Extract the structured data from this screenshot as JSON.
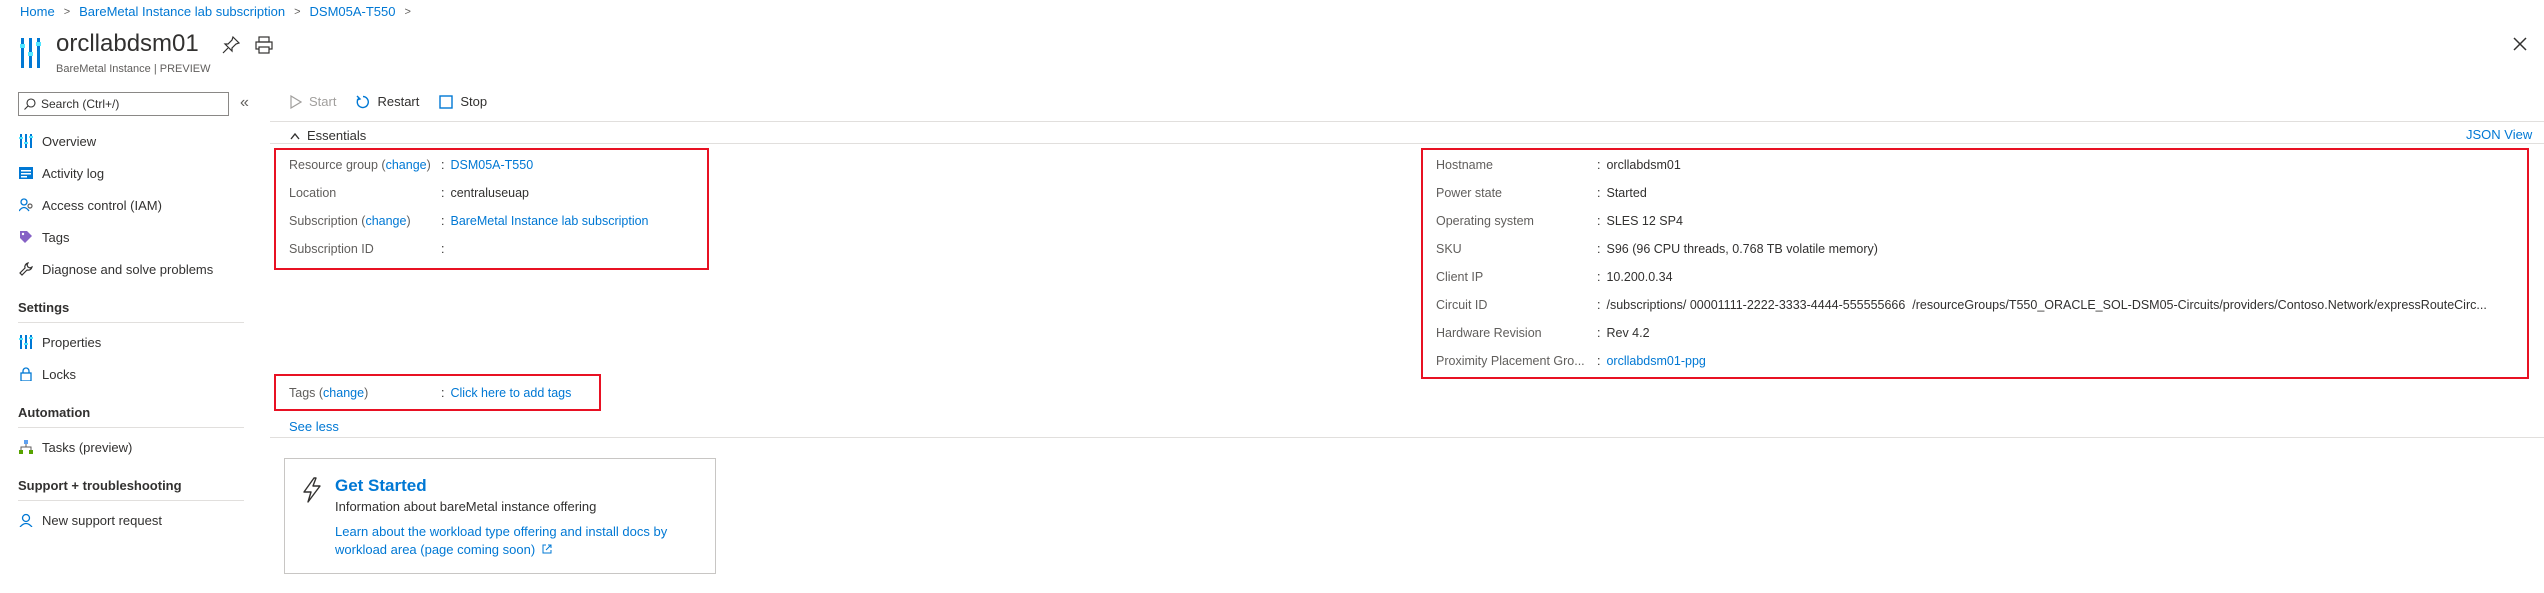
{
  "breadcrumb": [
    "Home",
    "BareMetal Instance lab subscription",
    "DSM05A-T550"
  ],
  "header": {
    "title": "orcllabdsm01",
    "subtitle": "BareMetal Instance | PREVIEW"
  },
  "sidebar": {
    "search_placeholder": "Search (Ctrl+/)",
    "items_top": [
      {
        "label": "Overview",
        "icon": "overview-icon"
      },
      {
        "label": "Activity log",
        "icon": "activity-log-icon"
      },
      {
        "label": "Access control (IAM)",
        "icon": "iam-icon"
      },
      {
        "label": "Tags",
        "icon": "tag-icon"
      },
      {
        "label": "Diagnose and solve problems",
        "icon": "wrench-icon"
      }
    ],
    "settings_title": "Settings",
    "settings_items": [
      {
        "label": "Properties",
        "icon": "properties-icon"
      },
      {
        "label": "Locks",
        "icon": "lock-icon"
      }
    ],
    "automation_title": "Automation",
    "automation_items": [
      {
        "label": "Tasks (preview)",
        "icon": "tasks-icon"
      }
    ],
    "support_title": "Support + troubleshooting",
    "support_items": [
      {
        "label": "New support request",
        "icon": "support-icon"
      }
    ]
  },
  "toolbar": {
    "start": "Start",
    "restart": "Restart",
    "stop": "Stop"
  },
  "essentials": {
    "toggle_label": "Essentials",
    "json_view": "JSON View",
    "left": {
      "resource_group_label": "Resource group",
      "change": "change",
      "resource_group_value": "DSM05A-T550",
      "location_label": "Location",
      "location_value": "centraluseuap",
      "subscription_label": "Subscription",
      "subscription_value": "BareMetal Instance lab subscription",
      "subscription_id_label": "Subscription ID",
      "subscription_id_value": ""
    },
    "right": [
      {
        "label": "Hostname",
        "value": "orcllabdsm01",
        "link": false
      },
      {
        "label": "Power state",
        "value": "Started",
        "link": false
      },
      {
        "label": "Operating system",
        "value": "SLES 12 SP4",
        "link": false
      },
      {
        "label": "SKU",
        "value": "S96 (96 CPU threads, 0.768 TB volatile memory)",
        "link": false
      },
      {
        "label": "Client IP",
        "value": "10.200.0.34",
        "link": false
      },
      {
        "label": "Circuit ID",
        "value": "/subscriptions/ 00001111-2222-3333-4444-555555666  /resourceGroups/T550_ORACLE_SOL-DSM05-Circuits/providers/Contoso.Network/expressRouteCirc...",
        "link": false
      },
      {
        "label": "Hardware Revision",
        "value": "Rev 4.2",
        "link": false
      },
      {
        "label": "Proximity Placement Gro...",
        "value": "orcllabdsm01-ppg",
        "link": true
      }
    ],
    "tags_label": "Tags",
    "tags_value": "Click here to add tags",
    "see_less": "See less"
  },
  "card": {
    "title": "Get Started",
    "description": "Information about bareMetal instance offering",
    "link_line1": "Learn about the workload type offering and install docs by",
    "link_line2": "workload area (page coming soon)"
  },
  "colors": {
    "accent": "#0078d4",
    "highlight": "#e81123",
    "text": "#323130"
  }
}
